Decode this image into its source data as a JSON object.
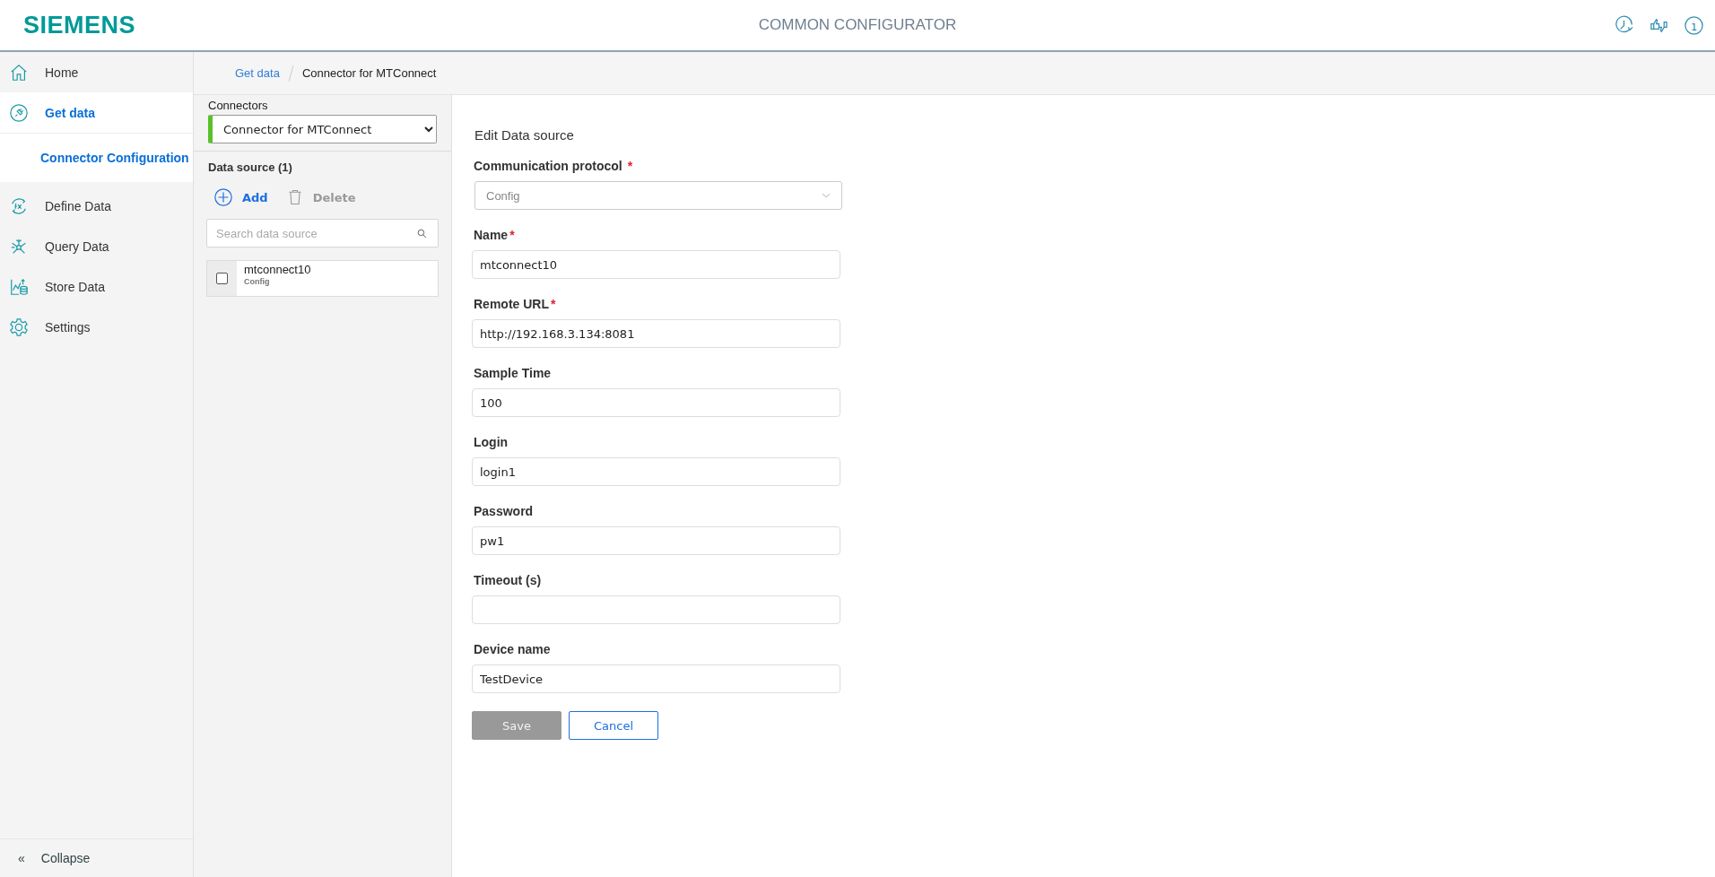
{
  "header": {
    "logo": "SIEMENS",
    "title": "COMMON CONFIGURATOR"
  },
  "sidebar": {
    "items": [
      {
        "label": "Home",
        "kind": "home",
        "selected": false
      },
      {
        "label": "Get data",
        "kind": "plug",
        "selected": true,
        "children": [
          {
            "label": "Connector Configuration",
            "selected": true
          }
        ]
      },
      {
        "label": "Define Data",
        "kind": "function",
        "selected": false
      },
      {
        "label": "Query Data",
        "kind": "network",
        "selected": false
      },
      {
        "label": "Store Data",
        "kind": "store",
        "selected": false
      },
      {
        "label": "Settings",
        "kind": "gear",
        "selected": false
      }
    ],
    "collapse": {
      "icon": "«",
      "label": "Collapse"
    }
  },
  "breadcrumb": [
    "Get data",
    "Connector for MTConnect"
  ],
  "connectors": {
    "label": "Connectors",
    "value": "Connector for MTConnect",
    "data_source_title": "Data source (1)",
    "actions": [
      {
        "label": "Add",
        "kind": "add",
        "disabled": false
      },
      {
        "label": "Delete",
        "kind": "delete",
        "disabled": true
      }
    ],
    "search": {
      "placeholder": "Search data source"
    },
    "items": [
      {
        "name": "mtconnect10",
        "type": "Config",
        "checked": false
      }
    ]
  },
  "form": {
    "title": "Edit Data source",
    "fields": [
      {
        "label": "Communication protocol",
        "required_mark": "*",
        "kind": "select",
        "value": "Config",
        "disabled": true
      },
      {
        "label": "Name",
        "required_mark": "*",
        "kind": "text",
        "value": "mtconnect10"
      },
      {
        "label": "Remote URL",
        "required_mark": "*",
        "kind": "text",
        "value": "http://192.168.3.134:8081"
      },
      {
        "label": "Sample Time",
        "kind": "text",
        "value": "100"
      },
      {
        "label": "Login",
        "kind": "text",
        "value": "login1"
      },
      {
        "label": "Password",
        "kind": "text",
        "value": "pw1"
      },
      {
        "label": "Timeout (s)",
        "kind": "text"
      },
      {
        "label": "Device name",
        "kind": "text",
        "value": "TestDevice"
      }
    ],
    "buttons": [
      {
        "label": "Save",
        "kind": "primary",
        "disabled": true
      },
      {
        "label": "Cancel",
        "kind": "secondary",
        "disabled": false
      }
    ]
  }
}
